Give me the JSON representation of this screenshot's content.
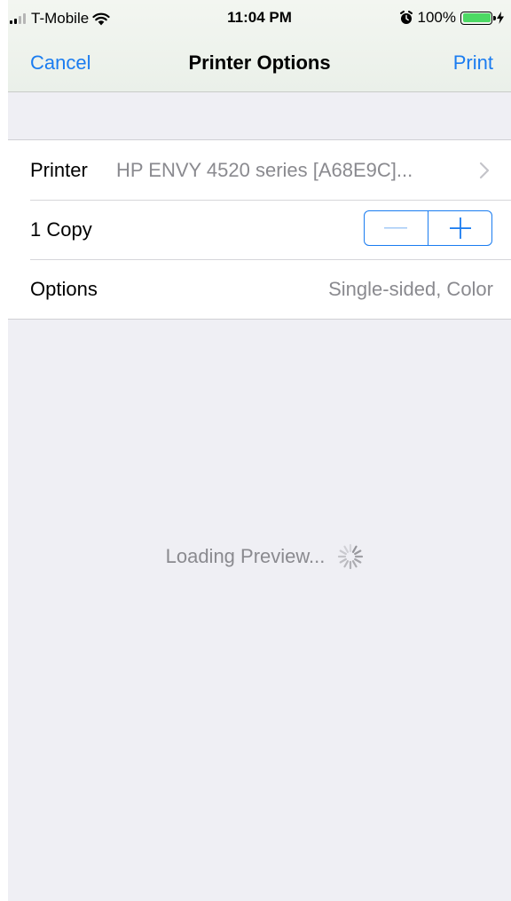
{
  "status_bar": {
    "carrier": "T-Mobile",
    "time": "11:04 PM",
    "battery": "100%",
    "battery_level": 1.0,
    "icons": [
      "signal-icon",
      "wifi-icon",
      "alarm-icon",
      "battery-icon",
      "charging-icon"
    ]
  },
  "nav": {
    "cancel_label": "Cancel",
    "title": "Printer Options",
    "print_label": "Print"
  },
  "settings": {
    "printer_label": "Printer",
    "printer_value": "HP ENVY 4520 series [A68E9C]...",
    "copies_label": "1 Copy",
    "options_label": "Options",
    "options_value": "Single-sided, Color"
  },
  "preview": {
    "loading_text": "Loading Preview..."
  },
  "colors": {
    "accent": "#1a7cf0",
    "secondary_text": "#8a8a8f",
    "background": "#efeff4",
    "battery": "#4cd964"
  }
}
